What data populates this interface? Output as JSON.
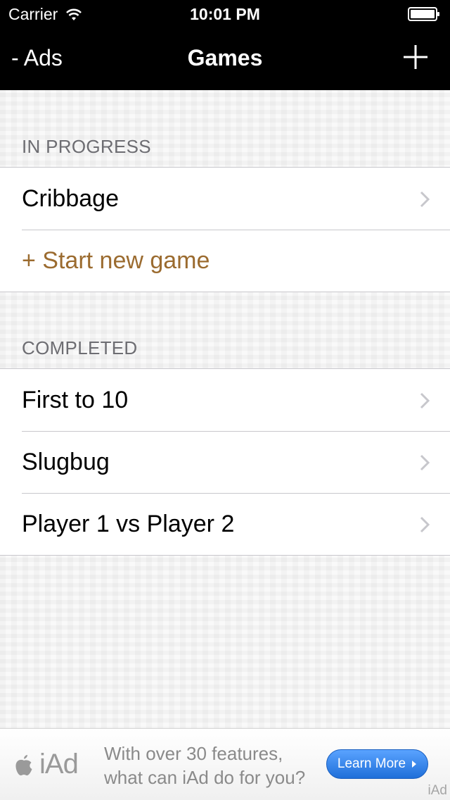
{
  "status_bar": {
    "carrier": "Carrier",
    "time": "10:01 PM"
  },
  "nav": {
    "left_label": "- Ads",
    "title": "Games"
  },
  "sections": {
    "in_progress": {
      "header": "IN PROGRESS",
      "items": [
        "Cribbage"
      ],
      "action": "+ Start new game"
    },
    "completed": {
      "header": "COMPLETED",
      "items": [
        "First to 10",
        "Slugbug",
        "Player 1 vs Player 2"
      ]
    }
  },
  "ad": {
    "brand": "iAd",
    "line1": "With over 30 features,",
    "line2": "what can iAd do for you?",
    "button": "Learn More",
    "corner_label": "iAd"
  },
  "colors": {
    "accent": "#9b6b2f",
    "bar": "#000000",
    "ad_button": "#2f7fe8"
  },
  "icons": [
    "wifi-icon",
    "battery-icon",
    "add-icon",
    "chevron-right-icon",
    "apple-icon"
  ]
}
